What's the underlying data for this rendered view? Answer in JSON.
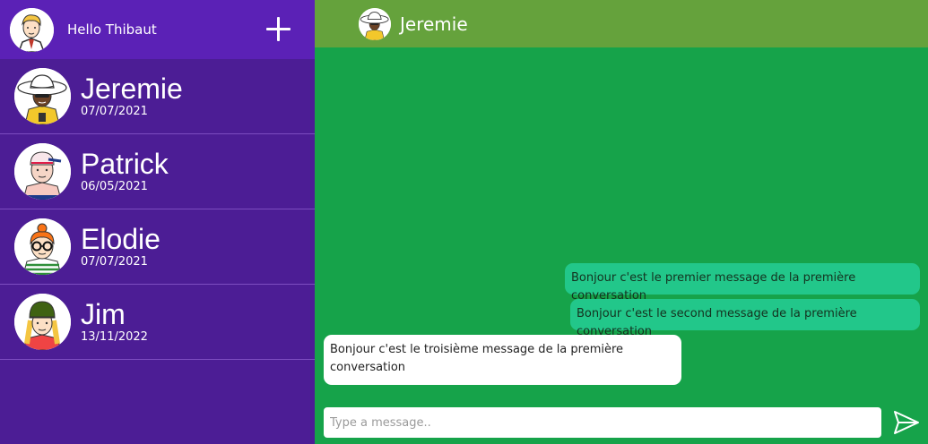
{
  "user": {
    "greeting": "Hello Thibaut",
    "avatar": "user-avatar-icon"
  },
  "conversations": [
    {
      "name": "Jeremie",
      "date": "07/07/2021",
      "avatar": "jeremie-avatar-icon"
    },
    {
      "name": "Patrick",
      "date": "06/05/2021",
      "avatar": "patrick-avatar-icon"
    },
    {
      "name": "Elodie",
      "date": "07/07/2021",
      "avatar": "elodie-avatar-icon"
    },
    {
      "name": "Jim",
      "date": "13/11/2022",
      "avatar": "jim-avatar-icon"
    }
  ],
  "chat": {
    "contact_name": "Jeremie",
    "messages": [
      {
        "text": "Bonjour c'est le premier message de la première conversation",
        "direction": "sent"
      },
      {
        "text": "Bonjour c'est le second message de la première conversation",
        "direction": "sent"
      },
      {
        "text": "Bonjour c'est le troisième message de la première conversation",
        "direction": "received"
      }
    ],
    "composer": {
      "placeholder": "Type a message.."
    }
  },
  "icons": {
    "new_conversation": "plus-icon",
    "send": "send-icon"
  },
  "colors": {
    "sidebar": "#4c1d95",
    "sidebar_header": "#5b21b6",
    "chat_background": "#16a34a",
    "chat_header": "#65a23c",
    "sent_bubble": "#22c78a",
    "received_bubble": "#ffffff"
  }
}
